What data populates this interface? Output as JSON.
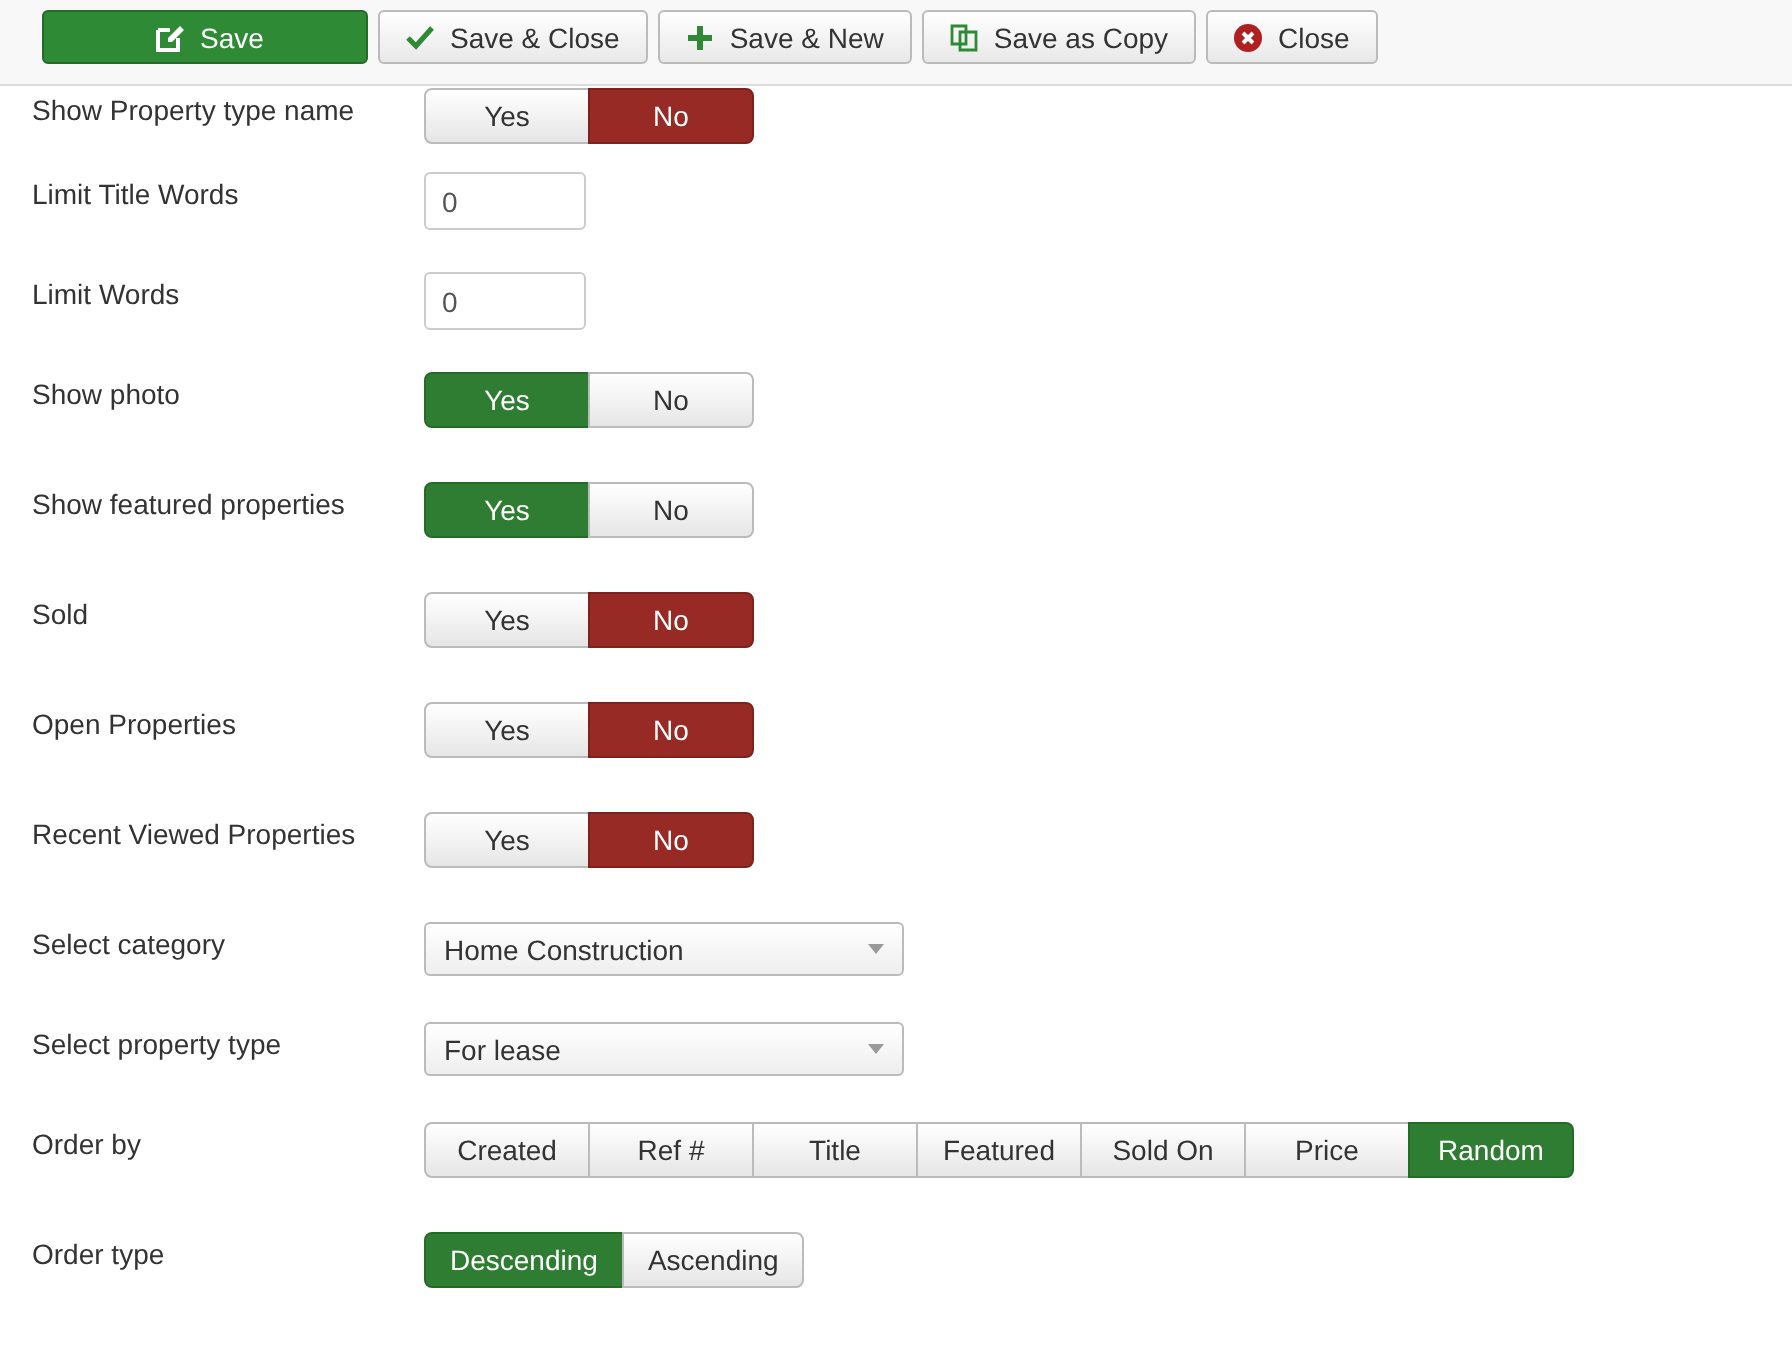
{
  "toolbar": [
    {
      "label": "Save",
      "kind": "edit",
      "primary": true
    },
    {
      "label": "Save & Close",
      "kind": "check",
      "primary": false
    },
    {
      "label": "Save & New",
      "kind": "plus",
      "primary": false
    },
    {
      "label": "Save as Copy",
      "kind": "copy",
      "primary": false
    },
    {
      "label": "Close",
      "kind": "close",
      "primary": false
    }
  ],
  "fields": [
    {
      "kind": "toggle",
      "label": "Show Property type name",
      "options": [
        {
          "label": "Yes",
          "selected": false
        },
        {
          "label": "No",
          "selected": true
        }
      ]
    },
    {
      "kind": "input",
      "label": "Limit Title Words",
      "value": "0"
    },
    {
      "kind": "input",
      "label": "Limit Words",
      "value": "0"
    },
    {
      "kind": "toggle",
      "label": "Show photo",
      "options": [
        {
          "label": "Yes",
          "selected": true
        },
        {
          "label": "No",
          "selected": false
        }
      ]
    },
    {
      "kind": "toggle",
      "label": "Show featured properties",
      "options": [
        {
          "label": "Yes",
          "selected": true
        },
        {
          "label": "No",
          "selected": false
        }
      ]
    },
    {
      "kind": "toggle",
      "label": "Sold",
      "options": [
        {
          "label": "Yes",
          "selected": false
        },
        {
          "label": "No",
          "selected": true
        }
      ]
    },
    {
      "kind": "toggle",
      "label": "Open Properties",
      "options": [
        {
          "label": "Yes",
          "selected": false
        },
        {
          "label": "No",
          "selected": true
        }
      ]
    },
    {
      "kind": "toggle",
      "label": "Recent Viewed Properties",
      "options": [
        {
          "label": "Yes",
          "selected": false
        },
        {
          "label": "No",
          "selected": true
        }
      ]
    },
    {
      "kind": "select",
      "label": "Select category",
      "value": "Home Construction"
    },
    {
      "kind": "select",
      "label": "Select property type",
      "value": "For lease"
    },
    {
      "kind": "choice",
      "label": "Order by",
      "options": [
        {
          "label": "Created",
          "selected": false
        },
        {
          "label": "Ref #",
          "selected": false
        },
        {
          "label": "Title",
          "selected": false
        },
        {
          "label": "Featured",
          "selected": false
        },
        {
          "label": "Sold On",
          "selected": false
        },
        {
          "label": "Price",
          "selected": false
        },
        {
          "label": "Random",
          "selected": true
        }
      ]
    },
    {
      "kind": "choice",
      "label": "Order type",
      "options": [
        {
          "label": "Descending",
          "selected": true
        },
        {
          "label": "Ascending",
          "selected": false
        }
      ]
    }
  ]
}
